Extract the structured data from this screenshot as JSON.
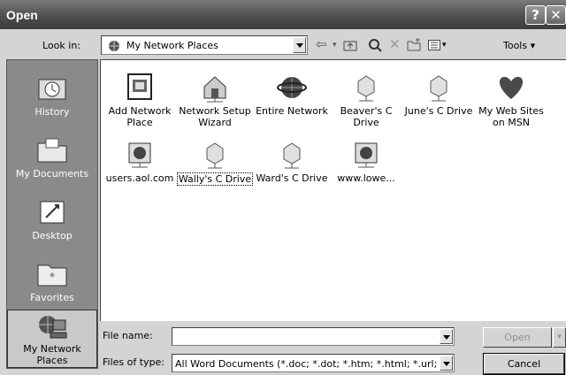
{
  "window": {
    "title": "Open",
    "help_glyph": "?",
    "close_glyph": "✕"
  },
  "toolbar": {
    "look_in_label": "Look in:",
    "look_in_value": "My Network Places",
    "tools_label": "Tools ▾",
    "icons": [
      "back-icon",
      "up-folder-icon",
      "search-web-icon",
      "delete-icon",
      "new-folder-icon",
      "views-icon"
    ]
  },
  "places": [
    {
      "label": "History",
      "icon": "history-icon"
    },
    {
      "label": "My Documents",
      "icon": "my-documents-icon"
    },
    {
      "label": "Desktop",
      "icon": "desktop-icon"
    },
    {
      "label": "Favorites",
      "icon": "favorites-icon"
    },
    {
      "label": "My Network\nPlaces",
      "icon": "network-places-icon"
    }
  ],
  "files": [
    {
      "label": "Add Network\nPlace",
      "icon": "add-network-place-icon"
    },
    {
      "label": "Network Setup\nWizard",
      "icon": "network-setup-icon"
    },
    {
      "label": "Entire Network",
      "icon": "entire-network-icon"
    },
    {
      "label": "Beaver's C\nDrive",
      "icon": "network-drive-icon"
    },
    {
      "label": "June's C Drive",
      "icon": "network-drive-icon"
    },
    {
      "label": "My Web Sites\non MSN",
      "icon": "msn-icon"
    },
    {
      "label": "users.aol.com",
      "icon": "web-folder-icon"
    },
    {
      "label": "Wally's C Drive",
      "icon": "network-drive-icon"
    },
    {
      "label": "Ward's C Drive",
      "icon": "network-drive-icon"
    },
    {
      "label": "www.lowe...",
      "icon": "web-folder-icon"
    }
  ],
  "footer": {
    "file_name_label": "File name:",
    "file_name_value": "",
    "file_type_label": "Files of type:",
    "file_type_value": "All Word Documents (*.doc; *.dot; *.htm; *.html; *.url; *",
    "open_label": "Open",
    "cancel_label": "Cancel"
  }
}
